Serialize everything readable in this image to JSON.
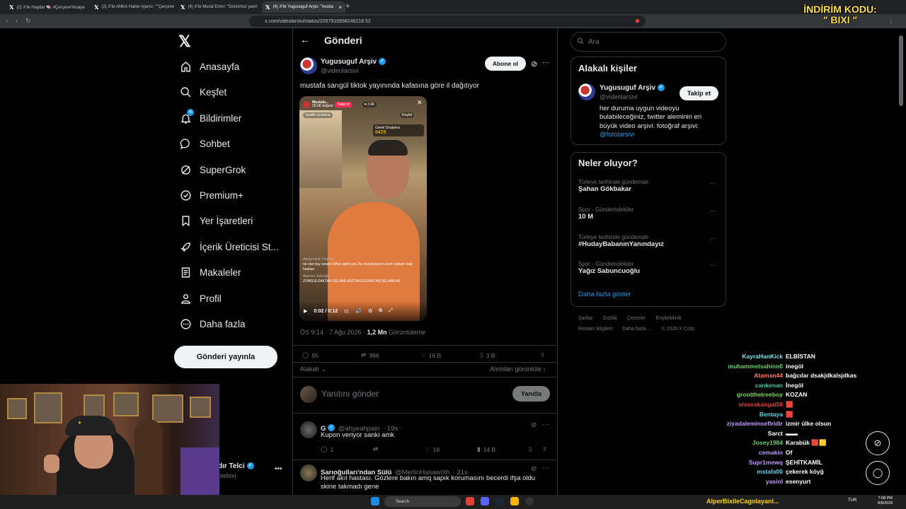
{
  "browser": {
    "tabs": [
      {
        "title": "(2) X'te Haydar 👒 #ÇerçeveYesaya"
      },
      {
        "title": "(2) X'te ANKA Haber Ajansı: \"\"Çerçeve"
      },
      {
        "title": "(4) X'te Murat Emirr: \"Dünümüz yarın"
      },
      {
        "title": "(4) X'te Yugusuguf Arşiv: \"musta"
      }
    ],
    "new_tab": "+",
    "url": "x.com/videolarsivi/status/2057916958246218 52"
  },
  "nav": {
    "items": [
      {
        "label": "Anasayfa",
        "icon": "home-icon"
      },
      {
        "label": "Keşfet",
        "icon": "search-icon"
      },
      {
        "label": "Bildirimler",
        "icon": "bell-icon",
        "badge": "4"
      },
      {
        "label": "Sohbet",
        "icon": "chat-icon"
      },
      {
        "label": "SuperGrok",
        "icon": "grok-icon"
      },
      {
        "label": "Premium+",
        "icon": "premium-icon"
      },
      {
        "label": "Yer İşaretleri",
        "icon": "bookmark-icon"
      },
      {
        "label": "İçerik Üreticisi St...",
        "icon": "rocket-icon"
      },
      {
        "label": "Makaleler",
        "icon": "article-icon"
      },
      {
        "label": "Profil",
        "icon": "person-icon"
      },
      {
        "label": "Daha fazla",
        "icon": "more-circle-icon"
      }
    ],
    "post_button": "Gönderi yayınla",
    "account": {
      "name": "dır Telci",
      "handle": "olebixi"
    }
  },
  "post": {
    "header_title": "Gönderi",
    "author": {
      "name": "Yugusuguf Arşiv",
      "handle": "@videolarsivi"
    },
    "subscribe_label": "Abone ol",
    "text": "mustafa sarıgül tiktok yayınında kafasına göre il dağıtıyor",
    "video": {
      "streamer": "Mustafa...",
      "viewers": "30,0K beğeni",
      "follow": "Takip et",
      "likes_badge": "3.9K",
      "explore": "Keşfet",
      "hourly": "Saatlik sıralama",
      "gift_label": "Genel Sıralama",
      "score": "8429",
      "comments": [
        {
          "user": "Abdurrahim Özpınar",
          "text": "ne olur duy sesimi Kiffen abim çok Zor durumdayım anem babam kalp hastası"
        },
        {
          "user": "Alperen Sofuoğlu",
          "text": "ZONGULDAKTAN SELAMLARZONGULDAKTAN SELAMLAR"
        }
      ],
      "time": "0:02 / 0:12"
    },
    "timestamp": "ÖS 9:14 · 7 Ağu 2026 · ",
    "views": "1,2 Mn",
    "views_label": " Görüntüleme",
    "stats": {
      "replies": "95",
      "reposts": "386",
      "likes": "16 B",
      "bookmarks": "3 B"
    },
    "related": "Alakalı",
    "quotes": "Alıntıları görüntüle",
    "reply_placeholder": "Yanıtını gönder",
    "reply_button": "Yanıtla"
  },
  "replies": [
    {
      "name": "G",
      "handle": "@ahyeahpain",
      "time": "· 19s",
      "text": "Kupon veriyor sanki amk",
      "replies": "1",
      "likes": "18",
      "views": "14 B"
    },
    {
      "name": "Sarıoğulları'ndan Sülü",
      "handle": "@MerlinHasaw0ih",
      "time": "· 21s",
      "text": "Herif akıl hastası. Gözlere bakın amq sapık korumasını becerdi ifşa oldu skine takmadı gene"
    }
  ],
  "sidebar": {
    "search_placeholder": "Ara",
    "related_title": "Alakalı kişiler",
    "related_person": {
      "name": "Yugusuguf Arşiv",
      "handle": "@videolarsivi",
      "bio": "her duruma uygun videoyu bulabileceğiniz, twitter aleminin en büyük video arşivi. fotoğraf arşivi:",
      "bio_link": "@fotolarsivi",
      "follow": "Takip et"
    },
    "trends_title": "Neler oluyor?",
    "trends": [
      {
        "category": "Türkiye tarihinde gündemde",
        "name": "Şahan Gökbakar"
      },
      {
        "category": "Spor · Gündemdekiler",
        "name": "10 M"
      },
      {
        "category": "Türkiye tarihinde gündemde",
        "name": "#HudayBabanınYanındayız"
      },
      {
        "category": "Spor · Gündemdekiler",
        "name": "Yağız Sabuncuoğlu"
      }
    ],
    "show_more": "Daha fazla göster",
    "footer_line1": [
      "Şartlar",
      "Gizlilik",
      "Çerezler",
      "Erişilebilirlik"
    ],
    "footer_line2": [
      "Reklam Bilgileri",
      "Daha fazla ...",
      "© 2026 X Corp."
    ]
  },
  "overlay": {
    "discount_line1": "İNDİRİM KODU:",
    "discount_line2": "\" BIXI \"",
    "chat": [
      {
        "user": "KayraHanKick",
        "msg": "ELBİSTAN",
        "color": "#7ee0e8"
      },
      {
        "user": "muhammetsahinn0",
        "msg": "inegöl",
        "color": "#6fd16f"
      },
      {
        "user": "Ataman44",
        "msg": "bağcılar dsakjdkalsjdkas",
        "color": "#ff7a6a"
      },
      {
        "user": "cankenan",
        "msg": "İnegöl",
        "color": "#4fc3a1"
      },
      {
        "user": "grootthetreeboy",
        "msg": "KOZAN",
        "color": "#7ed957"
      },
      {
        "user": "sivasskangal58",
        "msg": "🟥",
        "color": "#e0403a"
      },
      {
        "user": "Bentaya",
        "msg": "🟥",
        "color": "#5fd4e8"
      },
      {
        "user": "ziyadaleminseflridir",
        "msg": "izmir ülke olsun",
        "color": "#c39bff"
      },
      {
        "user": "Sarct",
        "msg": "▬▬",
        "color": "#ffffff"
      },
      {
        "user": "Josey1984",
        "msg": "Karabük 🟥🟨",
        "color": "#6fd16f"
      },
      {
        "user": "cemakin",
        "msg": "Of",
        "color": "#c39bff"
      },
      {
        "user": "Supr1mewq",
        "msg": "ŞEHİTKAMİL",
        "color": "#c39bff"
      },
      {
        "user": "mstafa00",
        "msg": "çekerek köyğ",
        "color": "#5fd4e8"
      },
      {
        "user": "yasinl",
        "msg": "esenyurt",
        "color": "#c39bff"
      }
    ],
    "ticker": "AlperBixileCagolayanl..."
  },
  "taskbar": {
    "search": "Search",
    "lang": "TUR",
    "time": "7:08 PM",
    "date": "8/8/2026"
  }
}
